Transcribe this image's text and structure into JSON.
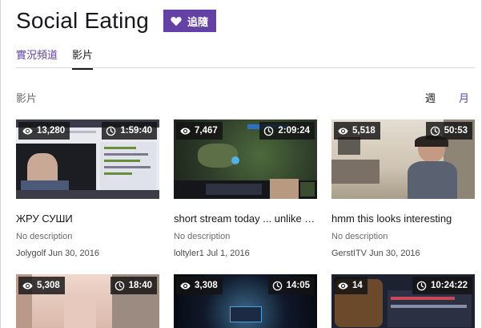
{
  "channel": {
    "title": "Social Eating",
    "follow_label": "追隨"
  },
  "tabs": [
    {
      "label": "實況頻道"
    },
    {
      "label": "影片"
    }
  ],
  "section": {
    "title": "影片",
    "periods": [
      {
        "label": "週"
      },
      {
        "label": "月",
        "selected": true
      }
    ]
  },
  "videos": [
    {
      "views": "13,280",
      "length": "1:59:40",
      "title": "ЖРУ СУШИ",
      "description": "No description",
      "meta": "Jolygolf Jun 30, 2016"
    },
    {
      "views": "7,467",
      "length": "2:09:24",
      "title": "short stream today ... unlike m...",
      "description": "No description",
      "meta": "loltyler1 Jul 1, 2016"
    },
    {
      "views": "5,518",
      "length": "50:53",
      "title": "hmm this looks interesting",
      "description": "No description",
      "meta": "GerstITV Jun 30, 2016"
    },
    {
      "views": "5,308",
      "length": "18:40"
    },
    {
      "views": "3,308",
      "length": "14:05"
    },
    {
      "views": "14",
      "length": "10:24:22"
    }
  ],
  "colors": {
    "accent": "#6441a4",
    "badge_bg": "#141414"
  }
}
